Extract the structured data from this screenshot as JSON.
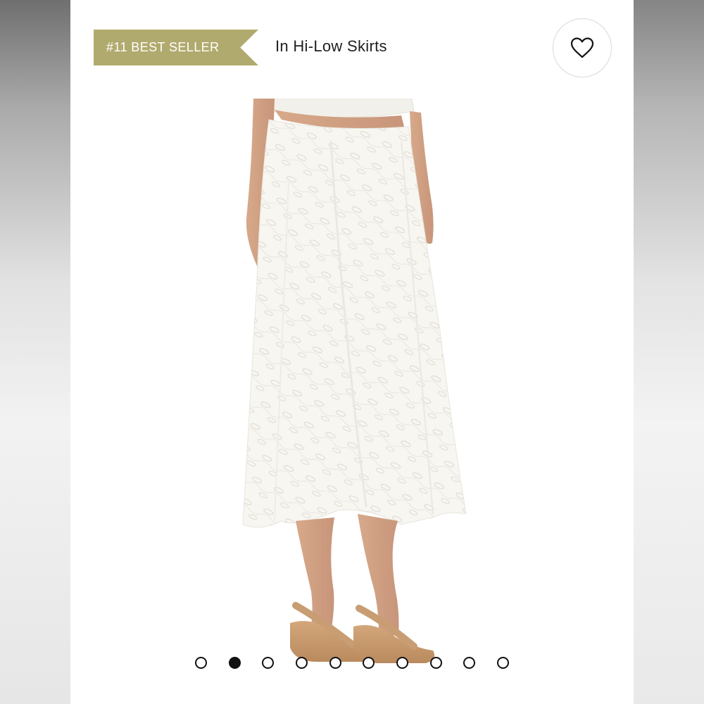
{
  "badge": {
    "label": "#11 BEST SELLER"
  },
  "category": {
    "label": "In Hi-Low Skirts"
  },
  "favorite": {
    "icon": "heart-icon"
  },
  "product_image": {
    "subject": "white lace hi-low midi skirt with tan wedge sandals"
  },
  "carousel": {
    "total": 10,
    "active_index": 1
  },
  "colors": {
    "badge": "#b1aa6e",
    "text": "#1f1f1f",
    "dot": "#111111"
  }
}
